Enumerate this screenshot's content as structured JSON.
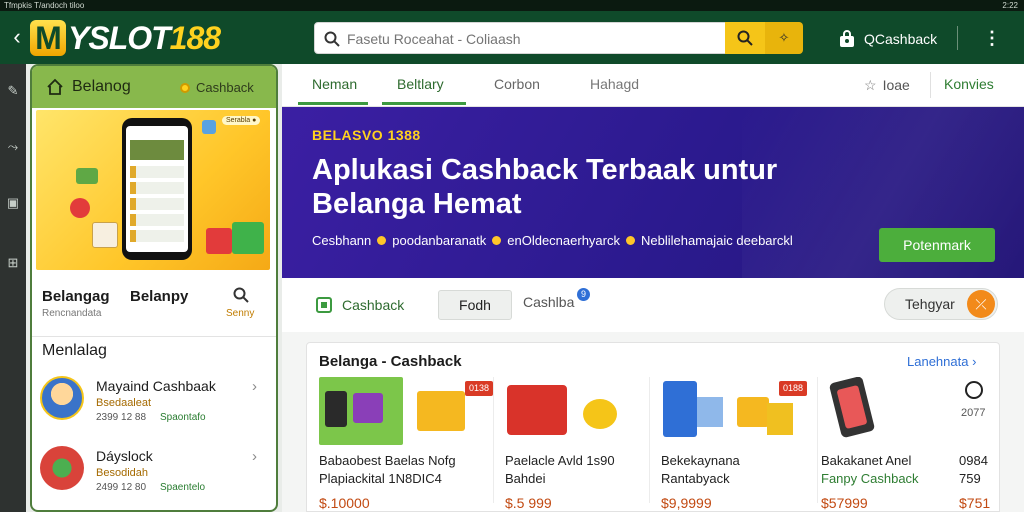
{
  "status": {
    "left": "Tfmpkis T/andoch tiloo",
    "right": "2:22"
  },
  "header": {
    "logo_m": "M",
    "logo_part1": "YSLOT",
    "logo_part2": "188",
    "search_placeholder": "Fasetu Roceahat - Coliaash",
    "cashback_label": "QCashback"
  },
  "left_panel": {
    "title": "Belanog",
    "cashback_label": "Cashback",
    "promo_tag": "Serabla ●",
    "tab_a": "Belangag",
    "tab_a_sub": "Rencnandata",
    "tab_b": "Belanpy",
    "search_sub": "Senny",
    "section_title": "Menlalag",
    "items": [
      {
        "name": "Mayaind Cashbaak",
        "sub": "Bsedaaleat",
        "meta": "2399 12 88",
        "status": "Spaontafo"
      },
      {
        "name": "Dáyslock",
        "sub": "Besodidah",
        "meta": "2499 12 80",
        "status": "Spaentelo"
      }
    ]
  },
  "main": {
    "tabs": [
      {
        "label": "Neman",
        "active": true
      },
      {
        "label": "Beltlary",
        "active": true
      },
      {
        "label": "Corbon",
        "active": false
      },
      {
        "label": "Hahagd",
        "active": false
      }
    ],
    "top_right_1": "Ioae",
    "top_right_2": "Konvies",
    "banner": {
      "kicker": "BELASVO 1388",
      "headline_1": "Aplukasi Cashback Terbaak untur",
      "headline_2": "Belanga Hemat",
      "features": [
        "Cesbhann",
        "poodanbaranatk",
        "enOldecnaerhyarck",
        "Neblilehamajaic deebarckl"
      ],
      "cta": "Potenmark"
    },
    "filters": {
      "cashback": "Cashback",
      "fodh": "Fodh",
      "cashba": "Cashlba",
      "cashba_badge": "9",
      "sort": "Tehgyar"
    },
    "products": {
      "title": "Belanga - Cashback",
      "see_all": "Lanehnata",
      "items": [
        {
          "line1": "Babaobest  Baelas Nofg",
          "line2": "Plapiackital  1N8DIC4",
          "price": "$.10000",
          "badge": "0138"
        },
        {
          "line1": "Paelacle  Avld  1s90",
          "line2": "Bahdei",
          "price": "$.5 999",
          "badge": ""
        },
        {
          "line1": "Bekekaynana",
          "line2": "Rantabyack",
          "price": "$9,9999",
          "badge": "0188"
        },
        {
          "line1": "Bakakanet Anel",
          "line2": "Fanpy Cashback",
          "price": "$57999",
          "badge": ""
        },
        {
          "line1": "0984",
          "line2": "759",
          "price": "$751",
          "badge": "2077"
        }
      ]
    }
  },
  "colors": {
    "header": "#0f4a2a",
    "accent_green": "#3c9a40",
    "banner": "#2b1a8e",
    "cta": "#4cae3c",
    "price": "#c24a12",
    "badge": "#d93a25",
    "yellow": "#f5c518"
  }
}
